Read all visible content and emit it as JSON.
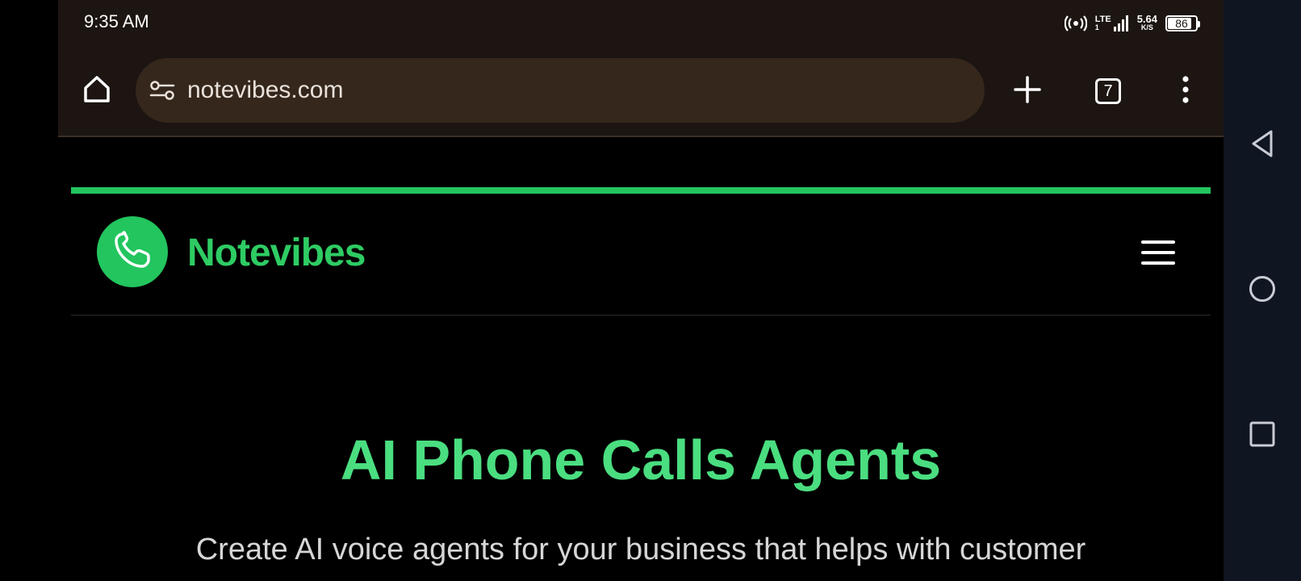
{
  "status_bar": {
    "time": "9:35 AM",
    "network_type": "LTE",
    "network_sub": "1",
    "net_speed_value": "5.64",
    "net_speed_unit": "K/S",
    "battery_level": "86",
    "battery_fraction": 0.86,
    "icons": [
      "hotspot-icon",
      "signal-icon",
      "battery-icon"
    ]
  },
  "browser": {
    "url": "notevibes.com",
    "tab_count": "7",
    "icons": [
      "home-icon",
      "site-settings-icon",
      "new-tab-icon",
      "tab-switcher-icon",
      "more-options-icon"
    ]
  },
  "site": {
    "brand_name": "Notevibes",
    "hero_title": "AI Phone Calls Agents",
    "hero_subtitle": "Create AI voice agents for your business that helps with customer",
    "colors": {
      "accent": "#22c55e",
      "brand_text": "#2ecc63",
      "hero_title": "#4ade80"
    }
  },
  "system_nav": {
    "icons": [
      "back-icon",
      "home-circle-icon",
      "recents-icon"
    ]
  }
}
